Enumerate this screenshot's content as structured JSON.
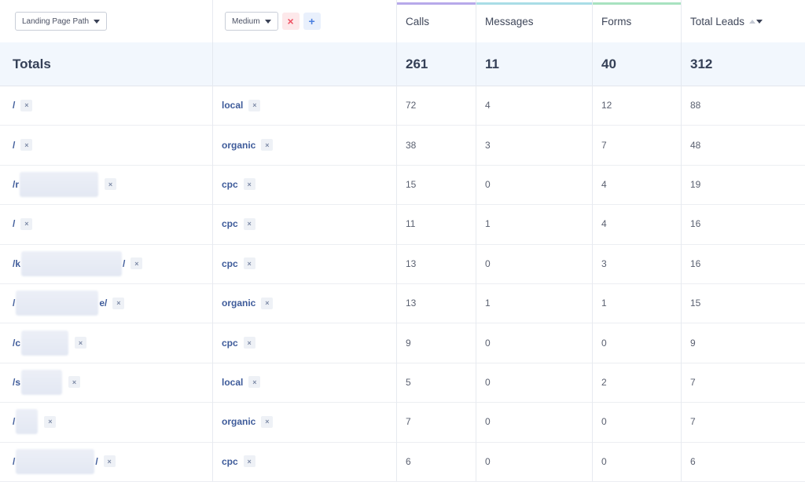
{
  "header": {
    "dimension1": {
      "label": "Landing Page Path"
    },
    "dimension2": {
      "label": "Medium"
    },
    "remove_glyph": "×",
    "add_glyph": "+",
    "metrics": [
      {
        "label": "Calls",
        "color": "#b7a9ea"
      },
      {
        "label": "Messages",
        "color": "#a9dde6"
      },
      {
        "label": "Forms",
        "color": "#a8e2c0"
      },
      {
        "label": "Total Leads",
        "color": "#ffffff"
      }
    ]
  },
  "totals": {
    "label": "Totals",
    "calls": "261",
    "messages": "11",
    "forms": "40",
    "total_leads": "312"
  },
  "chip_glyph": "×",
  "rows": [
    {
      "path_start": "/",
      "path_end": "",
      "medium": "local",
      "calls": "72",
      "messages": "4",
      "forms": "12",
      "total": "88"
    },
    {
      "path_start": "/",
      "path_end": "",
      "medium": "organic",
      "calls": "38",
      "messages": "3",
      "forms": "7",
      "total": "48"
    },
    {
      "path_start": "/r",
      "path_end": "",
      "medium": "cpc",
      "calls": "15",
      "messages": "0",
      "forms": "4",
      "total": "19"
    },
    {
      "path_start": "/",
      "path_end": "",
      "medium": "cpc",
      "calls": "11",
      "messages": "1",
      "forms": "4",
      "total": "16"
    },
    {
      "path_start": "/k",
      "path_end": "/",
      "medium": "cpc",
      "calls": "13",
      "messages": "0",
      "forms": "3",
      "total": "16"
    },
    {
      "path_start": "/",
      "path_end": "e/",
      "medium": "organic",
      "calls": "13",
      "messages": "1",
      "forms": "1",
      "total": "15"
    },
    {
      "path_start": "/c",
      "path_end": "",
      "medium": "cpc",
      "calls": "9",
      "messages": "0",
      "forms": "0",
      "total": "9"
    },
    {
      "path_start": "/s",
      "path_end": "",
      "medium": "local",
      "calls": "5",
      "messages": "0",
      "forms": "2",
      "total": "7"
    },
    {
      "path_start": "/",
      "path_end": "",
      "medium": "organic",
      "calls": "7",
      "messages": "0",
      "forms": "0",
      "total": "7"
    },
    {
      "path_start": "/",
      "path_end": "/",
      "medium": "cpc",
      "calls": "6",
      "messages": "0",
      "forms": "0",
      "total": "6"
    }
  ]
}
